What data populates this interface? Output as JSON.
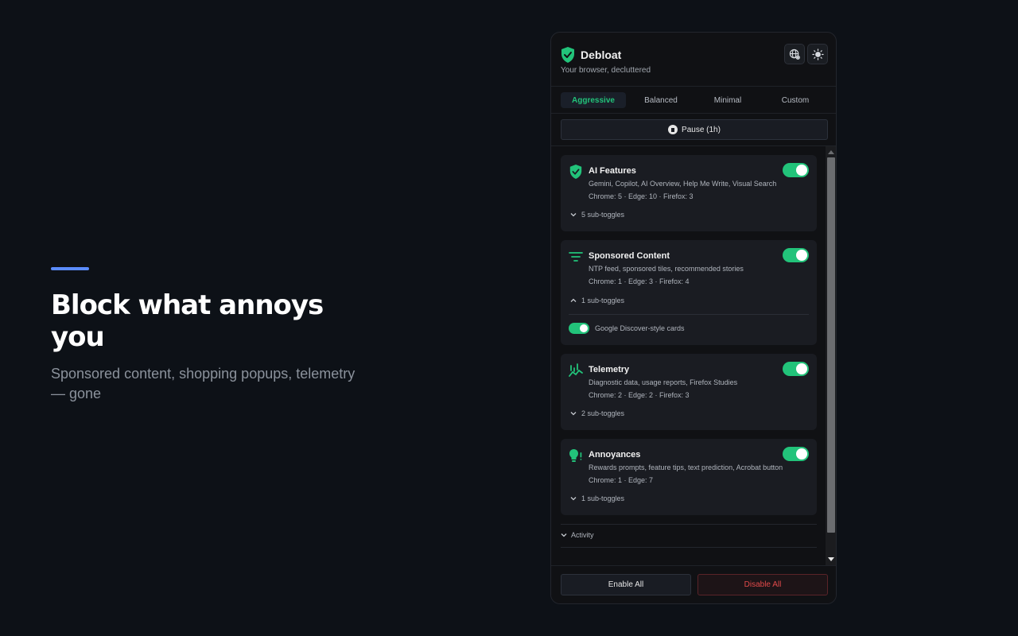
{
  "hero": {
    "title": "Block what annoys you",
    "subtitle": "Sponsored content, shopping popups, telemetry — gone"
  },
  "popup": {
    "brand": {
      "name": "Debloat",
      "tagline": "Your browser, decluttered",
      "icon": "shield-check-icon"
    },
    "header_icons": [
      "globe-settings-icon",
      "sun-icon"
    ],
    "tabs": [
      {
        "label": "Aggressive",
        "active": true
      },
      {
        "label": "Balanced",
        "active": false
      },
      {
        "label": "Minimal",
        "active": false
      },
      {
        "label": "Custom",
        "active": false
      }
    ],
    "pause_label": "Pause (1h)",
    "cards": [
      {
        "title": "AI Features",
        "icon": "shield-check-icon",
        "desc": "Gemini, Copilot, AI Overview, Help Me Write, Visual Search",
        "counts": "Chrome: 5 · Edge: 10 · Firefox: 3",
        "subtoggles": "5 sub-toggles",
        "enabled": true
      },
      {
        "title": "Sponsored Content",
        "icon": "filter-lines-icon",
        "desc": "NTP feed, sponsored tiles, recommended stories",
        "counts": "Chrome: 1 · Edge: 3 · Firefox: 4",
        "subtoggles": "1 sub-toggles",
        "enabled": true,
        "expanded_item": "Google Discover-style cards"
      },
      {
        "title": "Telemetry",
        "icon": "chart-activity-icon",
        "desc": "Diagnostic data, usage reports, Firefox Studies",
        "counts": "Chrome: 2 · Edge: 2 · Firefox: 3",
        "subtoggles": "2 sub-toggles",
        "enabled": true
      },
      {
        "title": "Annoyances",
        "icon": "lightbulb-alert-icon",
        "desc": "Rewards prompts, feature tips, text prediction, Acrobat button",
        "counts": "Chrome: 1 · Edge: 7",
        "subtoggles": "1 sub-toggles",
        "enabled": true
      }
    ],
    "activity_label": "Activity",
    "footer": {
      "enable_all": "Enable All",
      "disable_all": "Disable All"
    }
  },
  "colors": {
    "accent": "#22c37a",
    "hero_accent": "#5b8cff",
    "danger": "#e24a4a",
    "background": "#0d1117"
  }
}
